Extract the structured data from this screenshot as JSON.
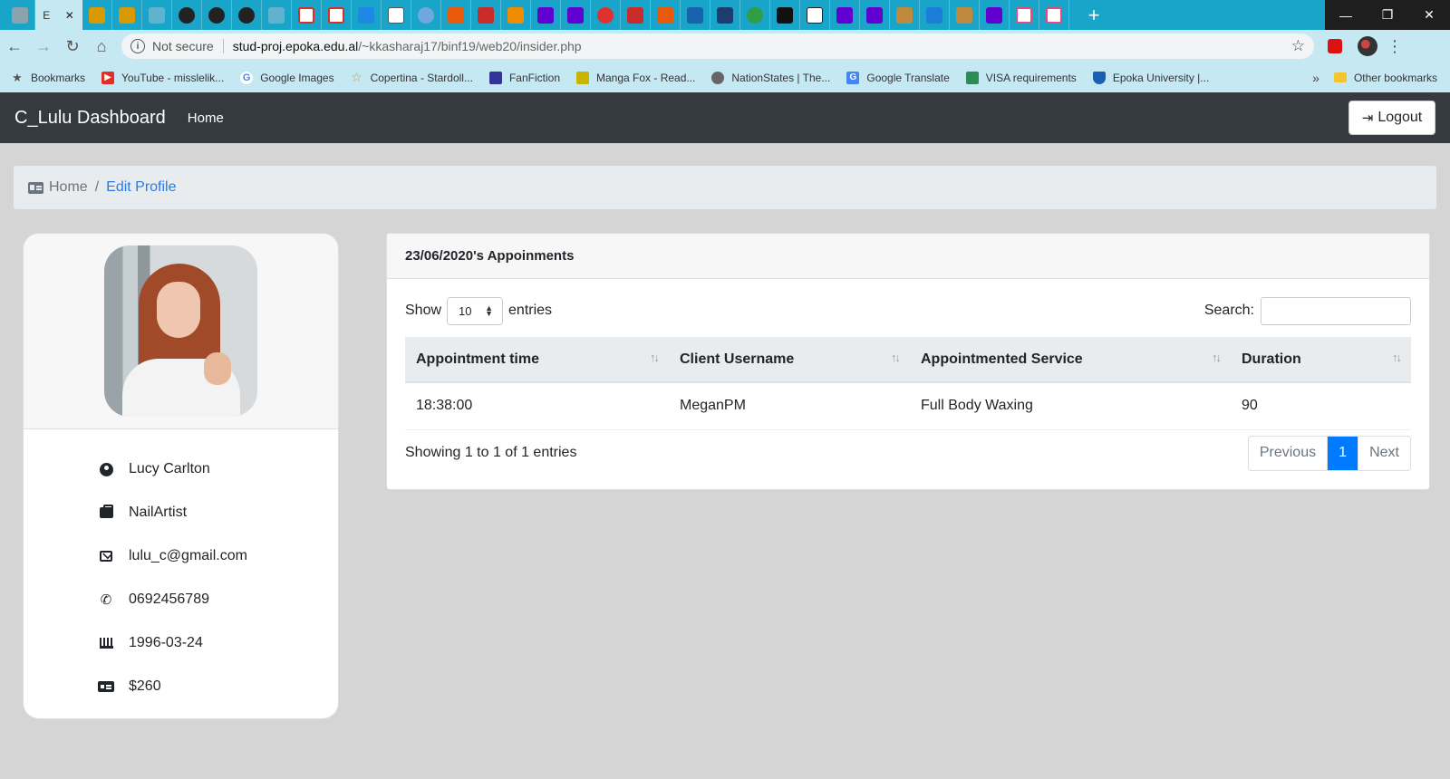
{
  "browser": {
    "active_tab_letter": "E",
    "tab_close": "✕",
    "new_tab": "+",
    "win_minimize": "—",
    "win_restore": "❐",
    "win_close": "✕",
    "not_secure": "Not secure",
    "url_host": "stud-proj.epoka.edu.al",
    "url_path": "/~kkasharaj17/binf19/web20/insider.php",
    "bookmarks": [
      {
        "label": "Bookmarks",
        "icon": "star-icon",
        "color": "#555555"
      },
      {
        "label": "YouTube - misslelik...",
        "icon": "youtube-icon",
        "color": "#e52d27"
      },
      {
        "label": "Google Images",
        "icon": "google-icon",
        "color": "#4285f4"
      },
      {
        "label": "Copertina - Stardoll...",
        "icon": "star-outline-icon",
        "color": "#d4a017"
      },
      {
        "label": "FanFiction",
        "icon": "fanfiction-icon",
        "color": "#333399"
      },
      {
        "label": "Manga Fox - Read...",
        "icon": "mangafox-icon",
        "color": "#c9b400"
      },
      {
        "label": "NationStates | The...",
        "icon": "globe-icon",
        "color": "#666666"
      },
      {
        "label": "Google Translate",
        "icon": "translate-icon",
        "color": "#4285f4"
      },
      {
        "label": "VISA requirements",
        "icon": "visa-icon",
        "color": "#2e8b57"
      },
      {
        "label": "Epoka University |...",
        "icon": "shield-icon",
        "color": "#1a5fb4"
      }
    ],
    "bookmarks_more": "»",
    "other_bookmarks": "Other bookmarks"
  },
  "app": {
    "brand": "C_Lulu Dashboard",
    "nav_home": "Home",
    "logout": "Logout"
  },
  "breadcrumb": {
    "home": "Home",
    "separator": "/",
    "current": "Edit Profile"
  },
  "profile": {
    "name": "Lucy Carlton",
    "role": "NailArtist",
    "email": "lulu_c@gmail.com",
    "phone": "0692456789",
    "birthdate": "1996-03-24",
    "balance": "$260"
  },
  "appointments": {
    "title": "23/06/2020's Appoinments",
    "show_label": "Show",
    "entries_label": "entries",
    "page_length": "10",
    "search_label": "Search:",
    "columns": [
      "Appointment time",
      "Client Username",
      "Appointmented Service",
      "Duration"
    ],
    "rows": [
      [
        "18:38:00",
        "MeganPM",
        "Full Body Waxing",
        "90"
      ]
    ],
    "info": "Showing 1 to 1 of 1 entries",
    "pager": {
      "previous": "Previous",
      "current": "1",
      "next": "Next"
    }
  },
  "colors": {
    "tab_strip": "#19a5c9",
    "toolbar": "#c6e8f3",
    "navbar": "#343a40",
    "link": "#2a7ae2",
    "primary": "#007bff"
  }
}
